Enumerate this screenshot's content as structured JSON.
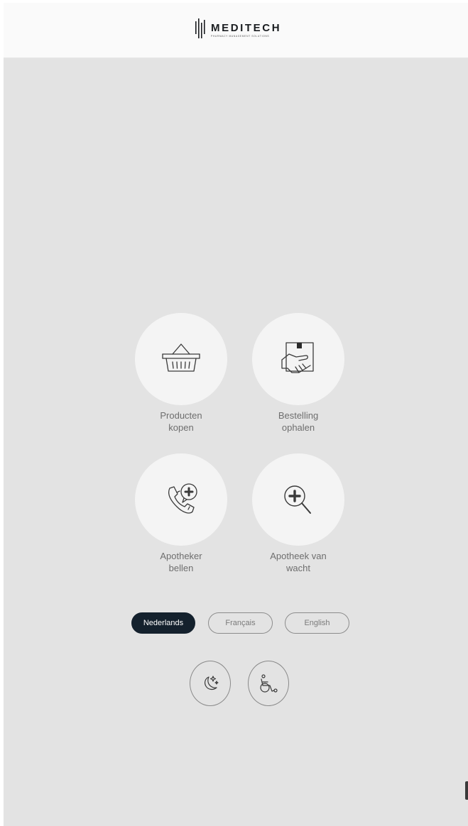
{
  "header": {
    "brand_name": "MEDITECH",
    "brand_tagline": "PHARMACY MANAGEMENT SOLUTIONS"
  },
  "tiles": [
    {
      "label": "Producten\nkopen",
      "icon": "shopping-basket-icon"
    },
    {
      "label": "Bestelling\nophalen",
      "icon": "package-in-hand-icon"
    },
    {
      "label": "Apotheker\nbellen",
      "icon": "phone-call-plus-icon"
    },
    {
      "label": "Apotheek van\nwacht",
      "icon": "search-plus-icon"
    }
  ],
  "languages": {
    "selected": "Nederlands",
    "options": [
      "Nederlands",
      "Français",
      "English"
    ]
  },
  "modes": [
    {
      "icon": "night-mode-icon"
    },
    {
      "icon": "wheelchair-accessibility-icon"
    }
  ],
  "colors": {
    "background": "#e3e3e3",
    "header": "#fafafa",
    "tile": "#f4f4f4",
    "active_language": "#14212d",
    "label": "#6e6e6e"
  }
}
